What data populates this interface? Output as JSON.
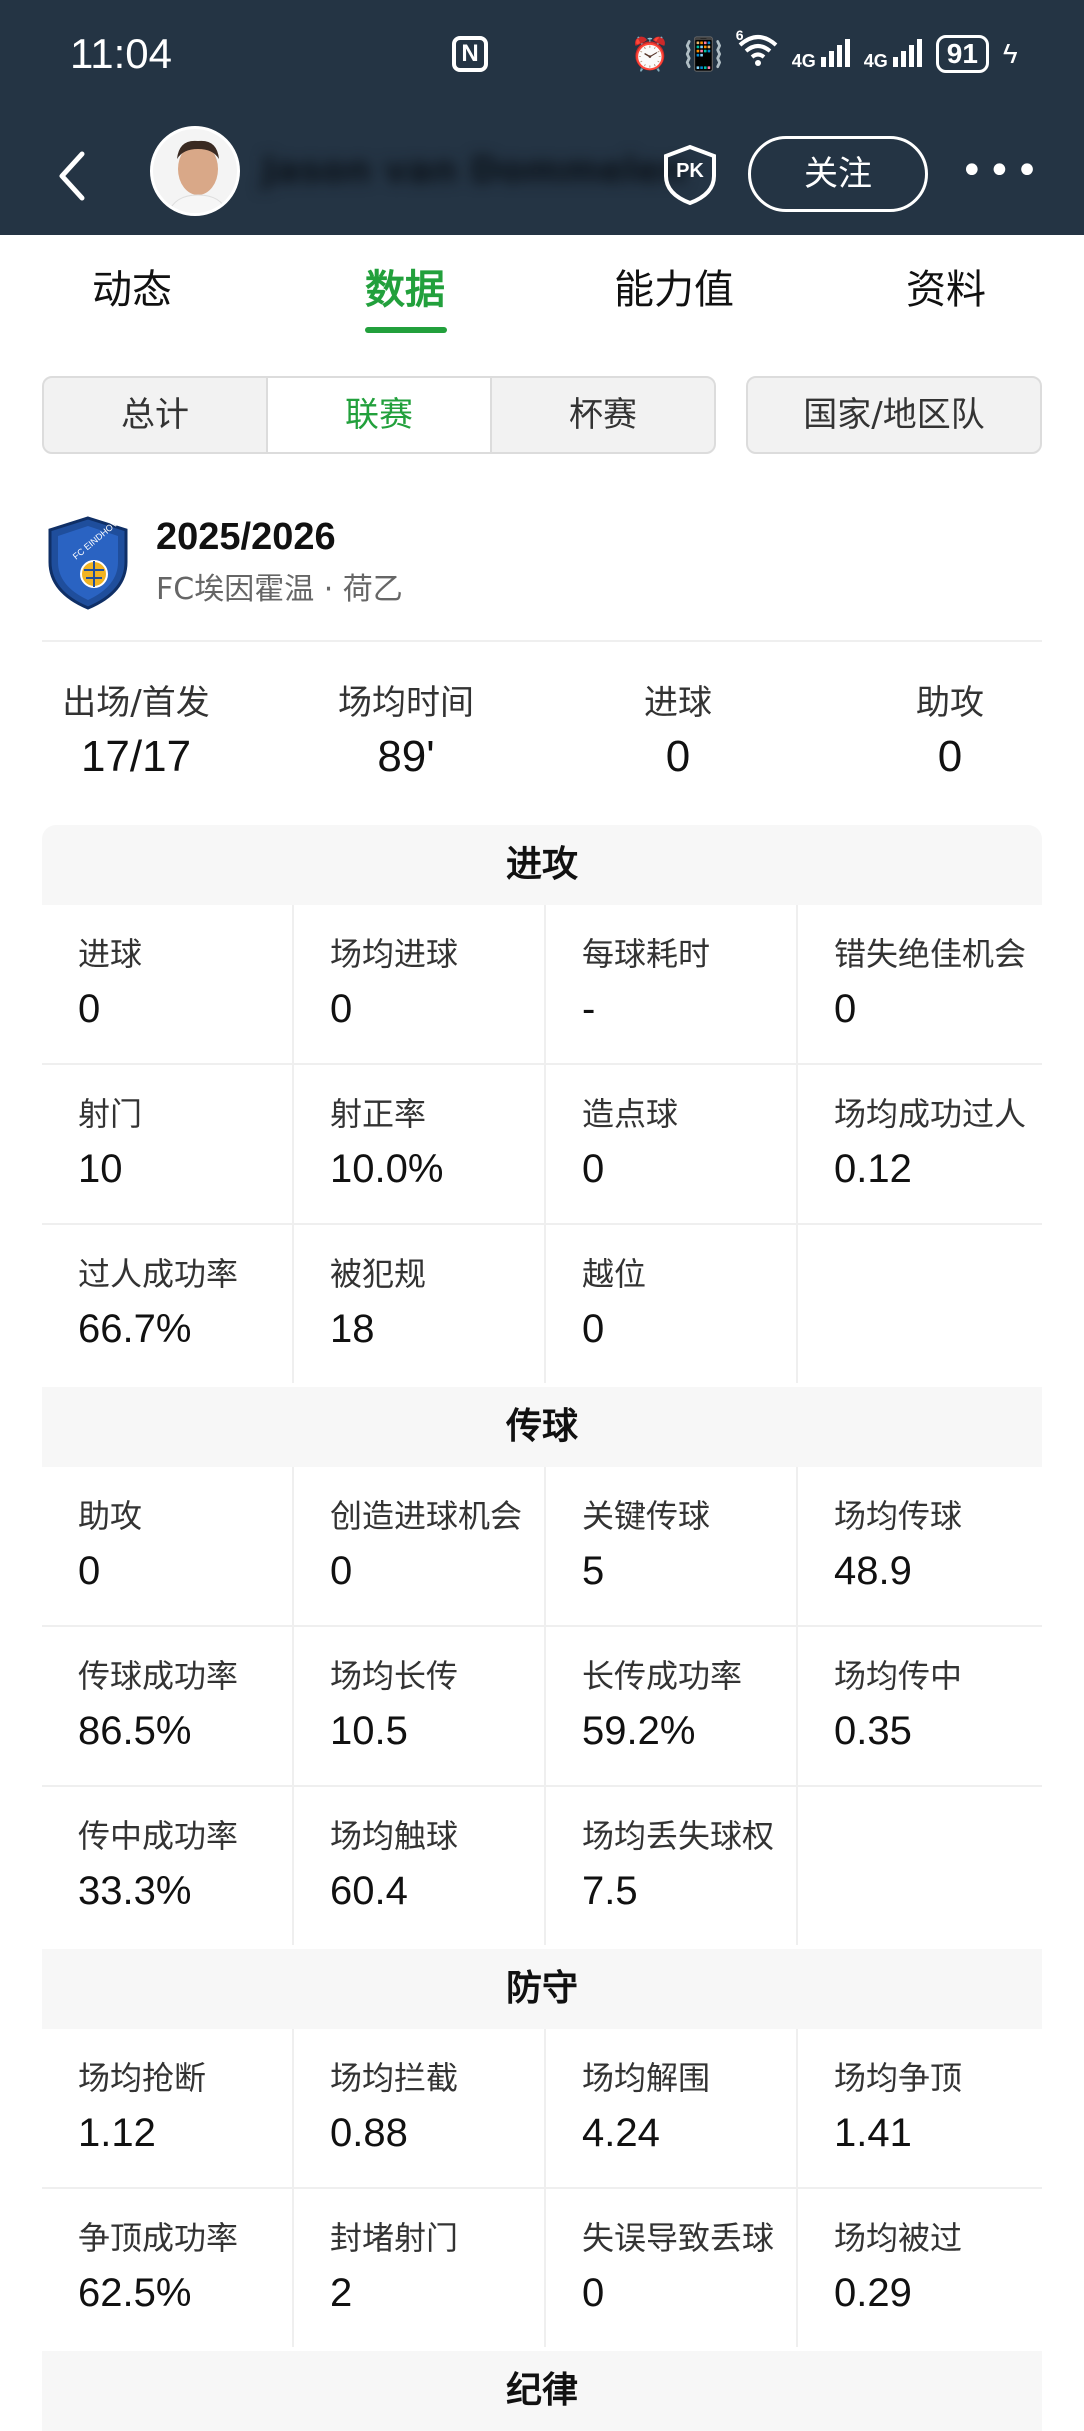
{
  "status_bar": {
    "time": "11:04",
    "nfc": "N",
    "sig1": "4G",
    "sig2": "4G",
    "wifi_badge": "6",
    "battery": "91"
  },
  "header": {
    "player_name": "Jason van Dommelen",
    "pk_label": "PK",
    "follow_label": "关注",
    "more_label": "•••"
  },
  "tabs": [
    {
      "label": "动态"
    },
    {
      "label": "数据"
    },
    {
      "label": "能力值"
    },
    {
      "label": "资料"
    }
  ],
  "segment": {
    "options": [
      {
        "label": "总计"
      },
      {
        "label": "联赛"
      },
      {
        "label": "杯赛"
      }
    ],
    "selected": "联赛",
    "national_label": "国家/地区队"
  },
  "season": {
    "year": "2025/2026",
    "team": "FC埃因霍温 · 荷乙",
    "crest_text": "FC EINDHOVEN"
  },
  "summary": [
    {
      "label": "出场/首发",
      "value": "17/17"
    },
    {
      "label": "场均时间",
      "value": "89'"
    },
    {
      "label": "进球",
      "value": "0"
    },
    {
      "label": "助攻",
      "value": "0"
    }
  ],
  "sections": {
    "attack": {
      "title": "进攻",
      "stats": [
        {
          "label": "进球",
          "value": "0"
        },
        {
          "label": "场均进球",
          "value": "0"
        },
        {
          "label": "每球耗时",
          "value": "-"
        },
        {
          "label": "错失绝佳机会",
          "value": "0"
        },
        {
          "label": "射门",
          "value": "10"
        },
        {
          "label": "射正率",
          "value": "10.0%"
        },
        {
          "label": "造点球",
          "value": "0"
        },
        {
          "label": "场均成功过人",
          "value": "0.12"
        },
        {
          "label": "过人成功率",
          "value": "66.7%"
        },
        {
          "label": "被犯规",
          "value": "18"
        },
        {
          "label": "越位",
          "value": "0"
        },
        {
          "label": "",
          "value": ""
        }
      ]
    },
    "passing": {
      "title": "传球",
      "stats": [
        {
          "label": "助攻",
          "value": "0"
        },
        {
          "label": "创造进球机会",
          "value": "0"
        },
        {
          "label": "关键传球",
          "value": "5"
        },
        {
          "label": "场均传球",
          "value": "48.9"
        },
        {
          "label": "传球成功率",
          "value": "86.5%"
        },
        {
          "label": "场均长传",
          "value": "10.5"
        },
        {
          "label": "长传成功率",
          "value": "59.2%"
        },
        {
          "label": "场均传中",
          "value": "0.35"
        },
        {
          "label": "传中成功率",
          "value": "33.3%"
        },
        {
          "label": "场均触球",
          "value": "60.4"
        },
        {
          "label": "场均丢失球权",
          "value": "7.5"
        },
        {
          "label": "",
          "value": ""
        }
      ]
    },
    "defense": {
      "title": "防守",
      "stats": [
        {
          "label": "场均抢断",
          "value": "1.12"
        },
        {
          "label": "场均拦截",
          "value": "0.88"
        },
        {
          "label": "场均解围",
          "value": "4.24"
        },
        {
          "label": "场均争顶",
          "value": "1.41"
        },
        {
          "label": "争顶成功率",
          "value": "62.5%"
        },
        {
          "label": "封堵射门",
          "value": "2"
        },
        {
          "label": "失误导致丢球",
          "value": "0"
        },
        {
          "label": "场均被过",
          "value": "0.29"
        }
      ]
    },
    "discipline": {
      "title": "纪律"
    }
  },
  "colors": {
    "header_bg": "#243444",
    "accent_green": "#22a03c",
    "section_bg": "#f7f7f7"
  }
}
